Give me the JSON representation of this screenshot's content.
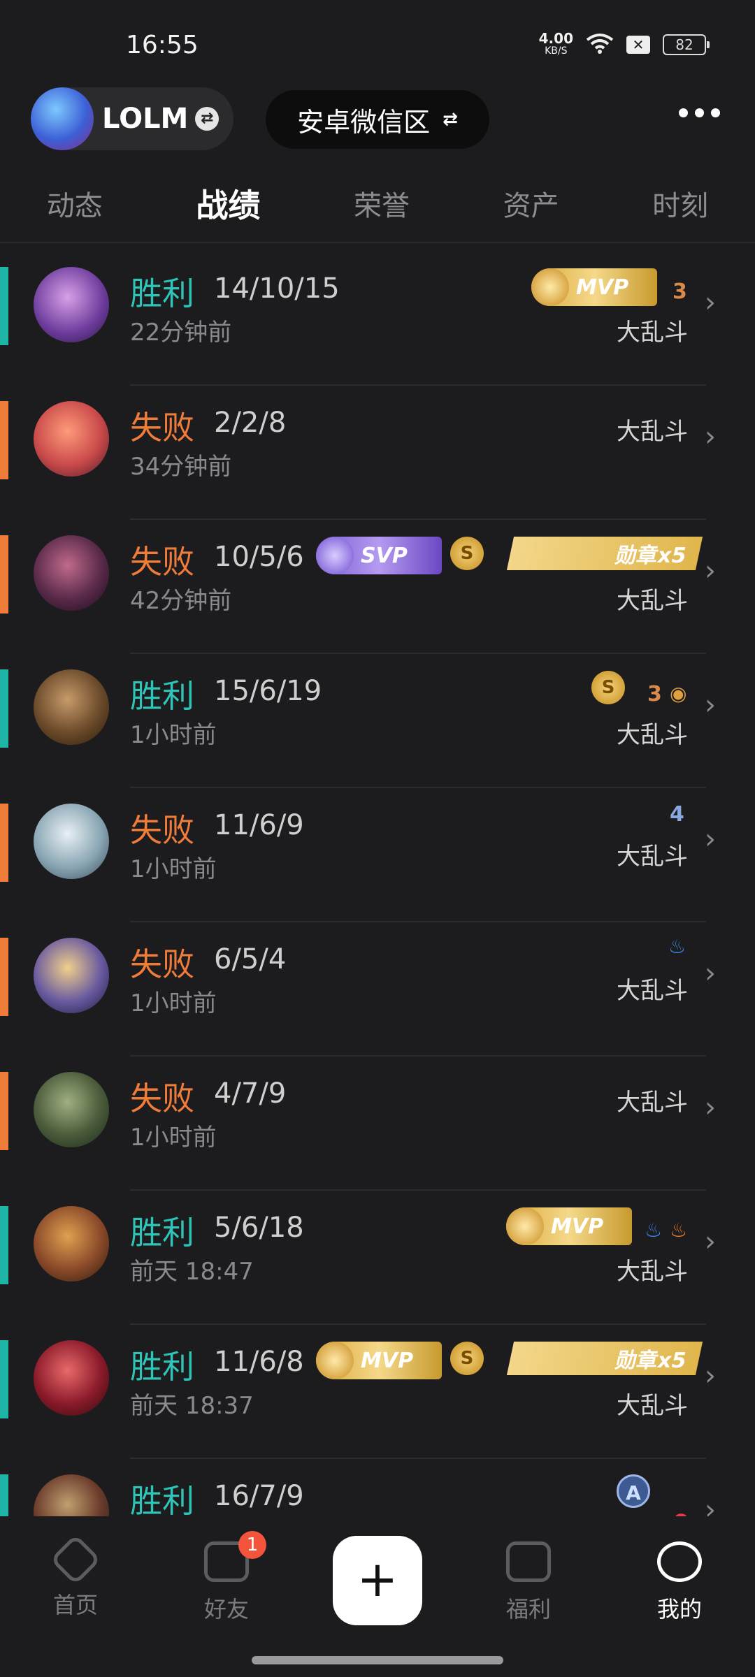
{
  "status": {
    "time": "16:55",
    "speed_value": "4.00",
    "speed_unit": "KB/S",
    "battery": "82"
  },
  "header": {
    "game_name": "LOLM",
    "server_name": "安卓微信区",
    "swap_symbol": "⇄"
  },
  "tabs": [
    {
      "label": "动态"
    },
    {
      "label": "战绩"
    },
    {
      "label": "荣誉"
    },
    {
      "label": "资产"
    },
    {
      "label": "时刻"
    }
  ],
  "matches": [
    {
      "result": "胜利",
      "kda": "14/10/15",
      "time": "22分钟前",
      "mode": "大乱斗",
      "mvp": "MVP",
      "num": "3",
      "color": "#2ec4b6"
    },
    {
      "result": "失败",
      "kda": "2/2/8",
      "time": "34分钟前",
      "mode": "大乱斗"
    },
    {
      "result": "失败",
      "kda": "10/5/6",
      "time": "42分钟前",
      "mode": "大乱斗",
      "svp": "SVP",
      "coin": "S",
      "medal": "勋章x5"
    },
    {
      "result": "胜利",
      "kda": "15/6/19",
      "time": "1小时前",
      "mode": "大乱斗",
      "coin": "S",
      "num": "3"
    },
    {
      "result": "失败",
      "kda": "11/6/9",
      "time": "1小时前",
      "mode": "大乱斗",
      "num": "4"
    },
    {
      "result": "失败",
      "kda": "6/5/4",
      "time": "1小时前",
      "mode": "大乱斗"
    },
    {
      "result": "失败",
      "kda": "4/7/9",
      "time": "1小时前",
      "mode": "大乱斗"
    },
    {
      "result": "胜利",
      "kda": "5/6/18",
      "time": "前天 18:47",
      "mode": "大乱斗",
      "mvp": "MVP"
    },
    {
      "result": "胜利",
      "kda": "11/6/8",
      "time": "前天 18:37",
      "mode": "大乱斗",
      "mvp": "MVP",
      "coin": "S",
      "medal": "勋章x5"
    },
    {
      "result": "胜利",
      "kda": "16/7/9",
      "time": "",
      "mode": "",
      "rank": "A"
    }
  ],
  "bottom_nav": {
    "home": "首页",
    "friends": "好友",
    "friends_badge": "1",
    "plus": "+",
    "welfare": "福利",
    "mine": "我的"
  }
}
